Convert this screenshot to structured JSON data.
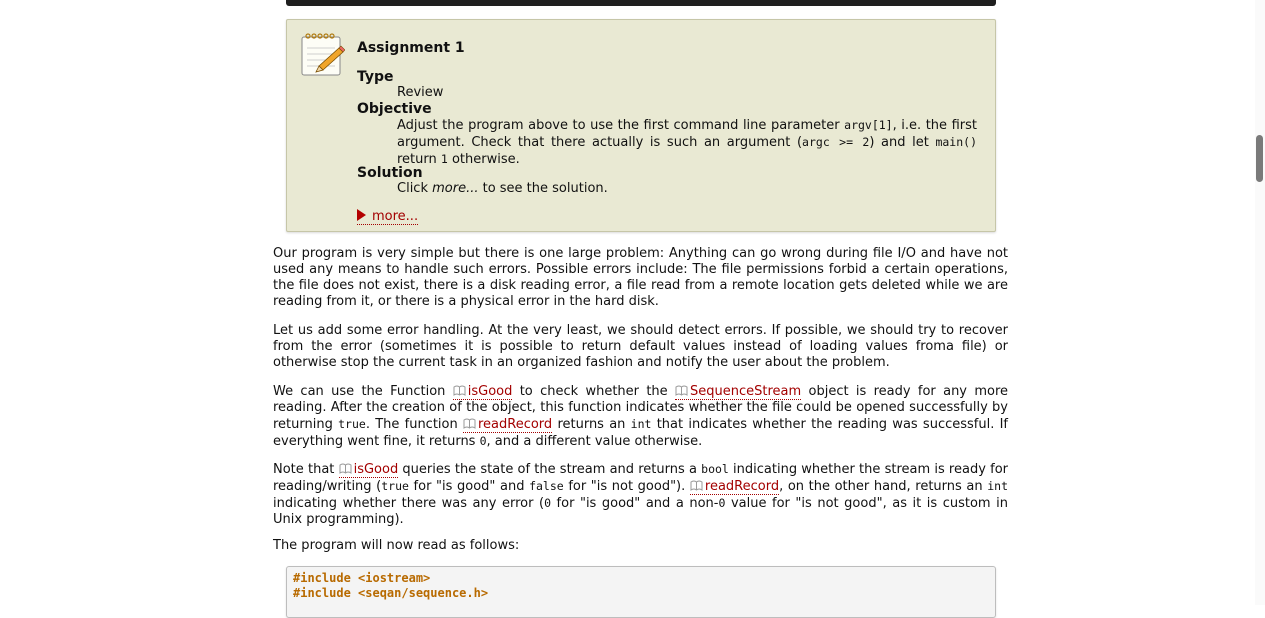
{
  "assignment": {
    "title": "Assignment 1",
    "type_label": "Type",
    "type_value": "Review",
    "objective_label": "Objective",
    "objective": {
      "p1": "Adjust the program above to use the first command line parameter ",
      "c1": "argv[1]",
      "p2": ", i.e. the first argument. Check that there actually is such an argument (",
      "c2": "argc >= 2",
      "p3": ") and let ",
      "c3": "main()",
      "p4": " return ",
      "c4": "1",
      "p5": " otherwise."
    },
    "solution_label": "Solution",
    "solution": {
      "p1": "Click ",
      "em": "more...",
      "p2": " to see the solution."
    },
    "more_label": "more..."
  },
  "paragraphs": {
    "p1": "Our program is very simple but there is one large problem: Anything can go wrong during file I/O and have not used any means to handle such errors. Possible errors include: The file permissions forbid a certain operations, the file does not exist, there is a disk reading error, a file read from a remote location gets deleted while we are reading from it, or there is a physical error in the hard disk.",
    "p2": "Let us add some error handling. At the very least, we should detect errors. If possible, we should try to recover from the error (sometimes it is possible to return default values instead of loading values froma file) or otherwise stop the current task in an organized fashion and notify the user about the problem.",
    "p3": {
      "t1": "We can use the Function ",
      "l1": "isGood",
      "t2": " to check whether the ",
      "l2": "SequenceStream",
      "t3": " object is ready for any more reading. After the creation of the object, this function indicates whether the file could be opened successfully by returning ",
      "c1": "true",
      "t4": ". The function ",
      "l3": "readRecord",
      "t5": " returns an ",
      "c2": "int",
      "t6": " that indicates whether the reading was successful. If everything went fine, it returns ",
      "c3": "0",
      "t7": ", and a different value otherwise."
    },
    "p4": {
      "t1": "Note that ",
      "l1": "isGood",
      "t2": " queries the state of the stream and returns a ",
      "c1": "bool",
      "t3": " indicating whether the stream is ready for reading/writing (",
      "c2": "true",
      "t4": " for \"is good\" and ",
      "c3": "false",
      "t5": " for \"is not good\"). ",
      "l2": "readRecord",
      "t6": ", on the other hand, returns an ",
      "c4": "int",
      "t7": " indicating whether there was any error (",
      "c5": "0",
      "t8": " for \"is good\" and a non-",
      "c6": "0",
      "t9": " value for \"is not good\", as it is custom in Unix programming)."
    },
    "p5": "The program will now read as follows:"
  },
  "code": {
    "line1": "#include <iostream>",
    "line2": "#include <seqan/sequence.h>"
  },
  "colors": {
    "link": "#a30000",
    "assignment_bg": "#e9e9d3",
    "code_keyword": "#b86a00"
  },
  "icons": {
    "assignment": "notepad-pencil-icon",
    "link": "book-icon",
    "more": "triangle-right-icon"
  }
}
